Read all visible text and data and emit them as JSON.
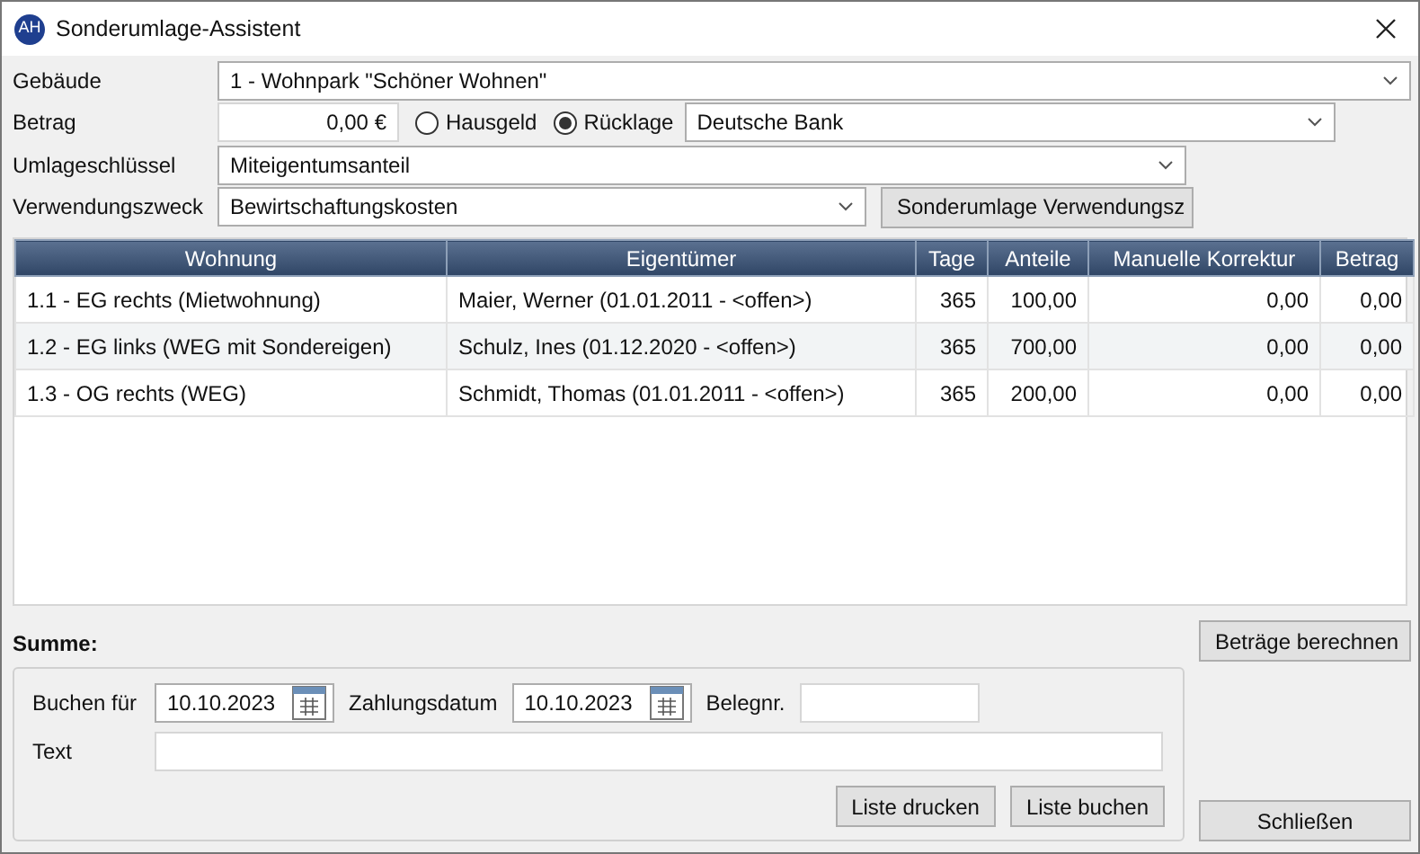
{
  "window": {
    "title": "Sonderumlage-Assistent",
    "logo": "AH"
  },
  "form": {
    "gebaeude": {
      "label": "Gebäude",
      "value": "1 - Wohnpark \"Schöner Wohnen\""
    },
    "betrag": {
      "label": "Betrag",
      "value": "0,00 €"
    },
    "konto_art": [
      {
        "label": "Hausgeld",
        "selected": false
      },
      {
        "label": "Rücklage",
        "selected": true
      }
    ],
    "bank": {
      "value": "Deutsche Bank"
    },
    "umlageschluessel": {
      "label": "Umlageschlüssel",
      "value": "Miteigentumsanteil"
    },
    "verwendungszweck": {
      "label": "Verwendungszweck",
      "value": "Bewirtschaftungskosten"
    },
    "verwendungszweck_button": "Sonderumlage Verwendungsz"
  },
  "table": {
    "columns": [
      "Wohnung",
      "Eigentümer",
      "Tage",
      "Anteile",
      "Manuelle Korrektur",
      "Betrag"
    ],
    "rows": [
      [
        "1.1 - EG rechts (Mietwohnung)",
        "Maier, Werner (01.01.2011 - <offen>)",
        "365",
        "100,00",
        "0,00",
        "0,00"
      ],
      [
        "1.2 - EG links (WEG mit Sondereigen)",
        "Schulz, Ines (01.12.2020 - <offen>)",
        "365",
        "700,00",
        "0,00",
        "0,00"
      ],
      [
        "1.3 - OG rechts (WEG)",
        "Schmidt, Thomas (01.01.2011 - <offen>)",
        "365",
        "200,00",
        "0,00",
        "0,00"
      ]
    ]
  },
  "summe": {
    "label": "Summe:"
  },
  "buchung": {
    "buchen_fuer": {
      "label": "Buchen für",
      "value": "10.10.2023"
    },
    "zahlungsdatum": {
      "label": "Zahlungsdatum",
      "value": "10.10.2023"
    },
    "belegnr": {
      "label": "Belegnr."
    },
    "text": {
      "label": "Text"
    },
    "buttons": [
      "Liste drucken",
      "Liste buchen"
    ]
  },
  "side_buttons": [
    "Beträge berechnen",
    "Schließen"
  ]
}
